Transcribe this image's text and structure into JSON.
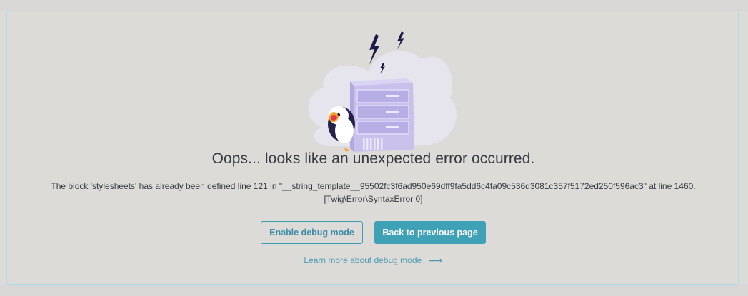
{
  "error_page": {
    "title": "Oops... looks like an unexpected error occurred.",
    "message_line1": "The block 'stylesheets' has already been defined line 121 in \"__string_template__95502fc3f6ad950e69dff9fa5dd6c4fa09c536d3081c357f5172ed250f596ac3\" at line 1460.",
    "message_line2": "[Twig\\Error\\SyntaxError 0]",
    "enable_debug_label": "Enable debug mode",
    "back_label": "Back to previous page",
    "learn_more_label": "Learn more about debug mode",
    "learn_more_arrow": "⟶"
  },
  "icons": {
    "illustration": "server-error-illustration",
    "mascot": "puffin-mascot-icon",
    "lightning": "lightning-icon",
    "arrow": "arrow-right-icon"
  },
  "colors": {
    "page_background": "#dcdbd9",
    "card_border": "#a9dbe8",
    "primary": "#3ea1b6",
    "text": "#363a41",
    "server": "#c8c0ec"
  }
}
